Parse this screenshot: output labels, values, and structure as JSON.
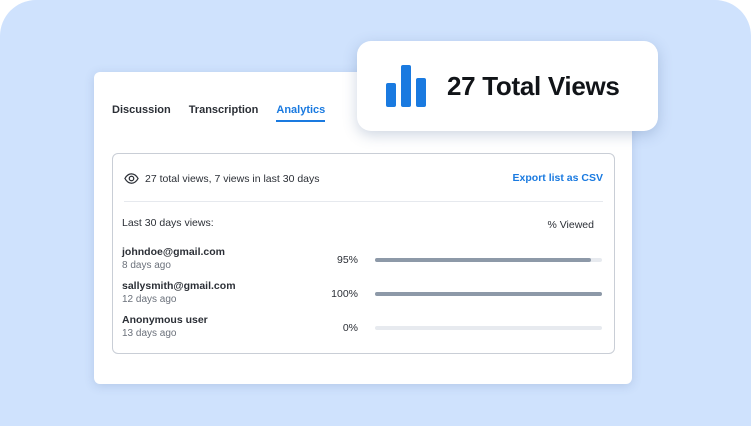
{
  "tabs": [
    {
      "label": "Discussion"
    },
    {
      "label": "Transcription"
    },
    {
      "label": "Analytics"
    }
  ],
  "active_tab": "Analytics",
  "summary": {
    "text": "27 total views, 7 views in last 30 days",
    "icon": "eye-icon",
    "export_label": "Export list as CSV"
  },
  "list": {
    "heading": "Last 30 days views:",
    "pct_header": "% Viewed",
    "rows": [
      {
        "name": "johndoe@gmail.com",
        "when": "8 days ago",
        "pct_label": "95%",
        "pct": 0.95
      },
      {
        "name": "sallysmith@gmail.com",
        "when": "12 days ago",
        "pct_label": "100%",
        "pct": 1.0
      },
      {
        "name": "Anonymous user",
        "when": "13 days ago",
        "pct_label": "0%",
        "pct": 0.0
      }
    ]
  },
  "callout": {
    "icon": "bar-chart-icon",
    "text": "27 Total Views"
  },
  "colors": {
    "accent": "#1a7ae0",
    "background": "#cfe2fd",
    "bar_fill": "#8d99a8",
    "bar_track": "#e7eaef"
  }
}
